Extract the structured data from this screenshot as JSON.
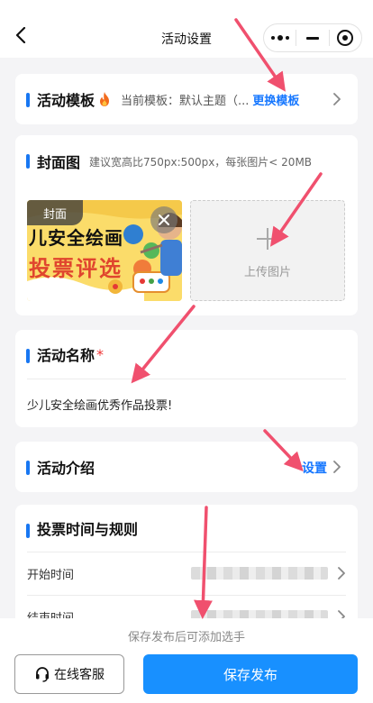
{
  "header": {
    "title": "活动设置",
    "back_icon": "chevron-left-icon",
    "capsule_icons": [
      "more-dots-icon",
      "minimize-icon",
      "close-circle-icon"
    ]
  },
  "template": {
    "title": "活动模板",
    "badge_icon": "flame-icon",
    "current": "当前模板：默认主题（...",
    "change_label": "更换模板"
  },
  "cover": {
    "title": "封面图",
    "hint": "建议宽高比750px:500px，每张图片< 20MB",
    "image_tag": "封面",
    "image_caption_line1": "儿安全绘画",
    "image_caption_line2": "投票评选",
    "upload_label": "上传图片"
  },
  "name": {
    "title": "活动名称",
    "required_mark": "*",
    "value": "少儿安全绘画优秀作品投票!"
  },
  "intro": {
    "title": "活动介绍",
    "action_label": "设置"
  },
  "time_rules": {
    "title": "投票时间与规则",
    "rows": [
      {
        "label": "开始时间"
      },
      {
        "label": "结束时间"
      }
    ]
  },
  "footer": {
    "hint": "保存发布后可添加选手",
    "service_label": "在线客服",
    "service_icon": "headset-icon",
    "save_label": "保存发布"
  },
  "colors": {
    "accent": "#1877f2",
    "link": "#1677ff",
    "primary_button": "#1890ff",
    "annotation_arrow": "#f0506e",
    "background": "#f4f4f6"
  }
}
